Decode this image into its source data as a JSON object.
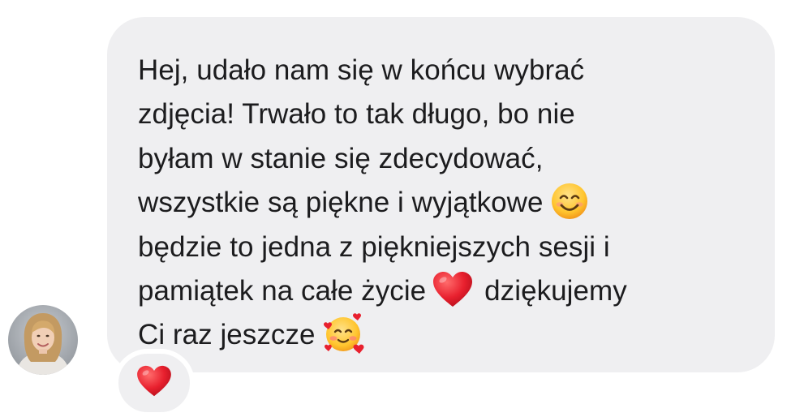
{
  "message": {
    "lines": [
      {
        "text": "Hej, udało nam się w końcu wybrać",
        "emoji": ""
      },
      {
        "text": "zdjęcia! Trwało to tak długo, bo nie",
        "emoji": ""
      },
      {
        "text": "byłam w stanie się zdecydować,",
        "emoji": ""
      },
      {
        "text": "wszystkie są piękne i wyjątkowe",
        "emoji": "smiling-face-icon"
      },
      {
        "text": "będzie to jedna z piękniejszych sesji i",
        "emoji": ""
      },
      {
        "text": "pamiątek na całe życie",
        "emoji": "red-heart-icon",
        "after": "dziękujemy"
      },
      {
        "text": "Ci raz jeszcze",
        "emoji": "smiling-face-with-hearts-icon"
      }
    ],
    "bubble_color": "#efeff1",
    "text_color": "#1c1c1e"
  },
  "sender": {
    "avatar_icon": "avatar-photo"
  },
  "reaction": {
    "icon": "red-heart-icon",
    "color": "#e8202e"
  }
}
